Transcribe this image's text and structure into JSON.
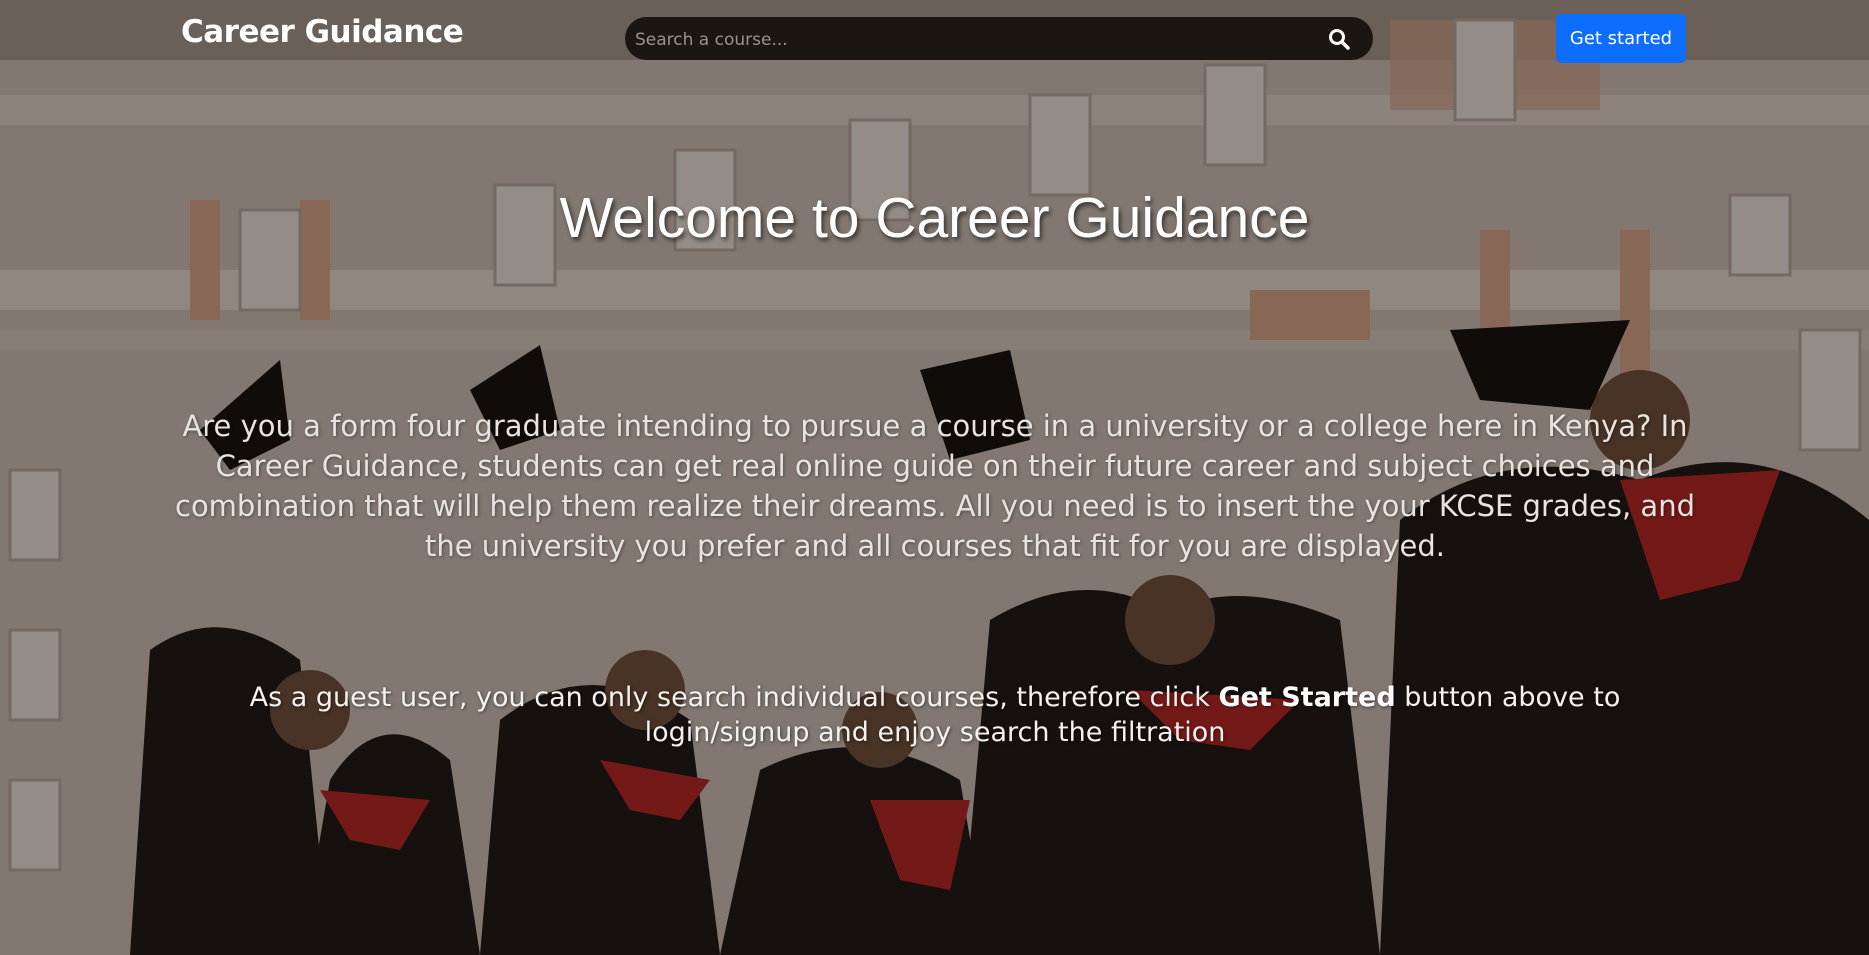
{
  "navbar": {
    "brand": "Career Guidance",
    "search": {
      "placeholder": "Search a course...",
      "icon": "search-icon"
    },
    "cta_label": "Get started"
  },
  "hero": {
    "title": "Welcome to Career Guidance",
    "intro": "Are you a form four graduate intending to pursue a course in a university or a college here in Kenya? In Career Guidance, students can get real online guide on their future career and subject choices and combination that will help them realize their dreams. All you need is to insert the your KCSE grades, and the university you prefer and all courses that fit for you are displayed.",
    "guest_prefix": "As a guest user, you can only search individual courses, therefore click ",
    "guest_highlight": "Get Started",
    "guest_suffix": " button above to login/signup and enjoy search the filtration"
  },
  "colors": {
    "accent": "#0d6efd",
    "search_bg": "#1c1613",
    "text": "#ffffff"
  }
}
